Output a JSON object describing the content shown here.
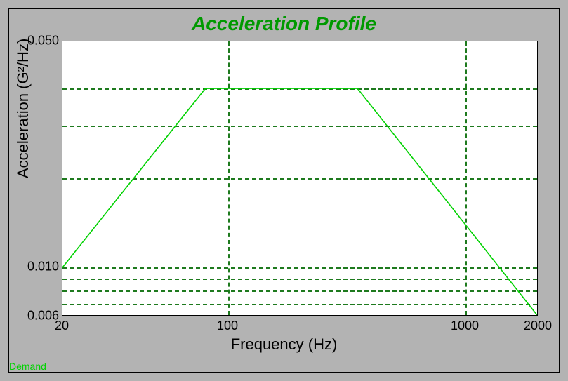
{
  "title": "Acceleration Profile",
  "xlabel": "Frequency (Hz)",
  "ylabel": "Acceleration (G²/Hz)",
  "legend": "Demand",
  "xticks": [
    "20",
    "100",
    "1000",
    "2000"
  ],
  "yticks": [
    "0.006",
    "0.010",
    "0.050"
  ],
  "chart_data": {
    "type": "line",
    "title": "Acceleration Profile",
    "xlabel": "Frequency (Hz)",
    "ylabel": "Acceleration (G²/Hz)",
    "x_scale": "log",
    "y_scale": "log",
    "xlim": [
      20,
      2000
    ],
    "ylim": [
      0.006,
      0.05
    ],
    "x_ticks": [
      20,
      100,
      1000,
      2000
    ],
    "y_ticks": [
      0.006,
      0.01,
      0.05
    ],
    "grid": "dashed",
    "series": [
      {
        "name": "Demand",
        "color": "#00d200",
        "x": [
          20,
          80,
          350,
          2000
        ],
        "y": [
          0.01,
          0.04,
          0.04,
          0.006
        ]
      }
    ]
  }
}
